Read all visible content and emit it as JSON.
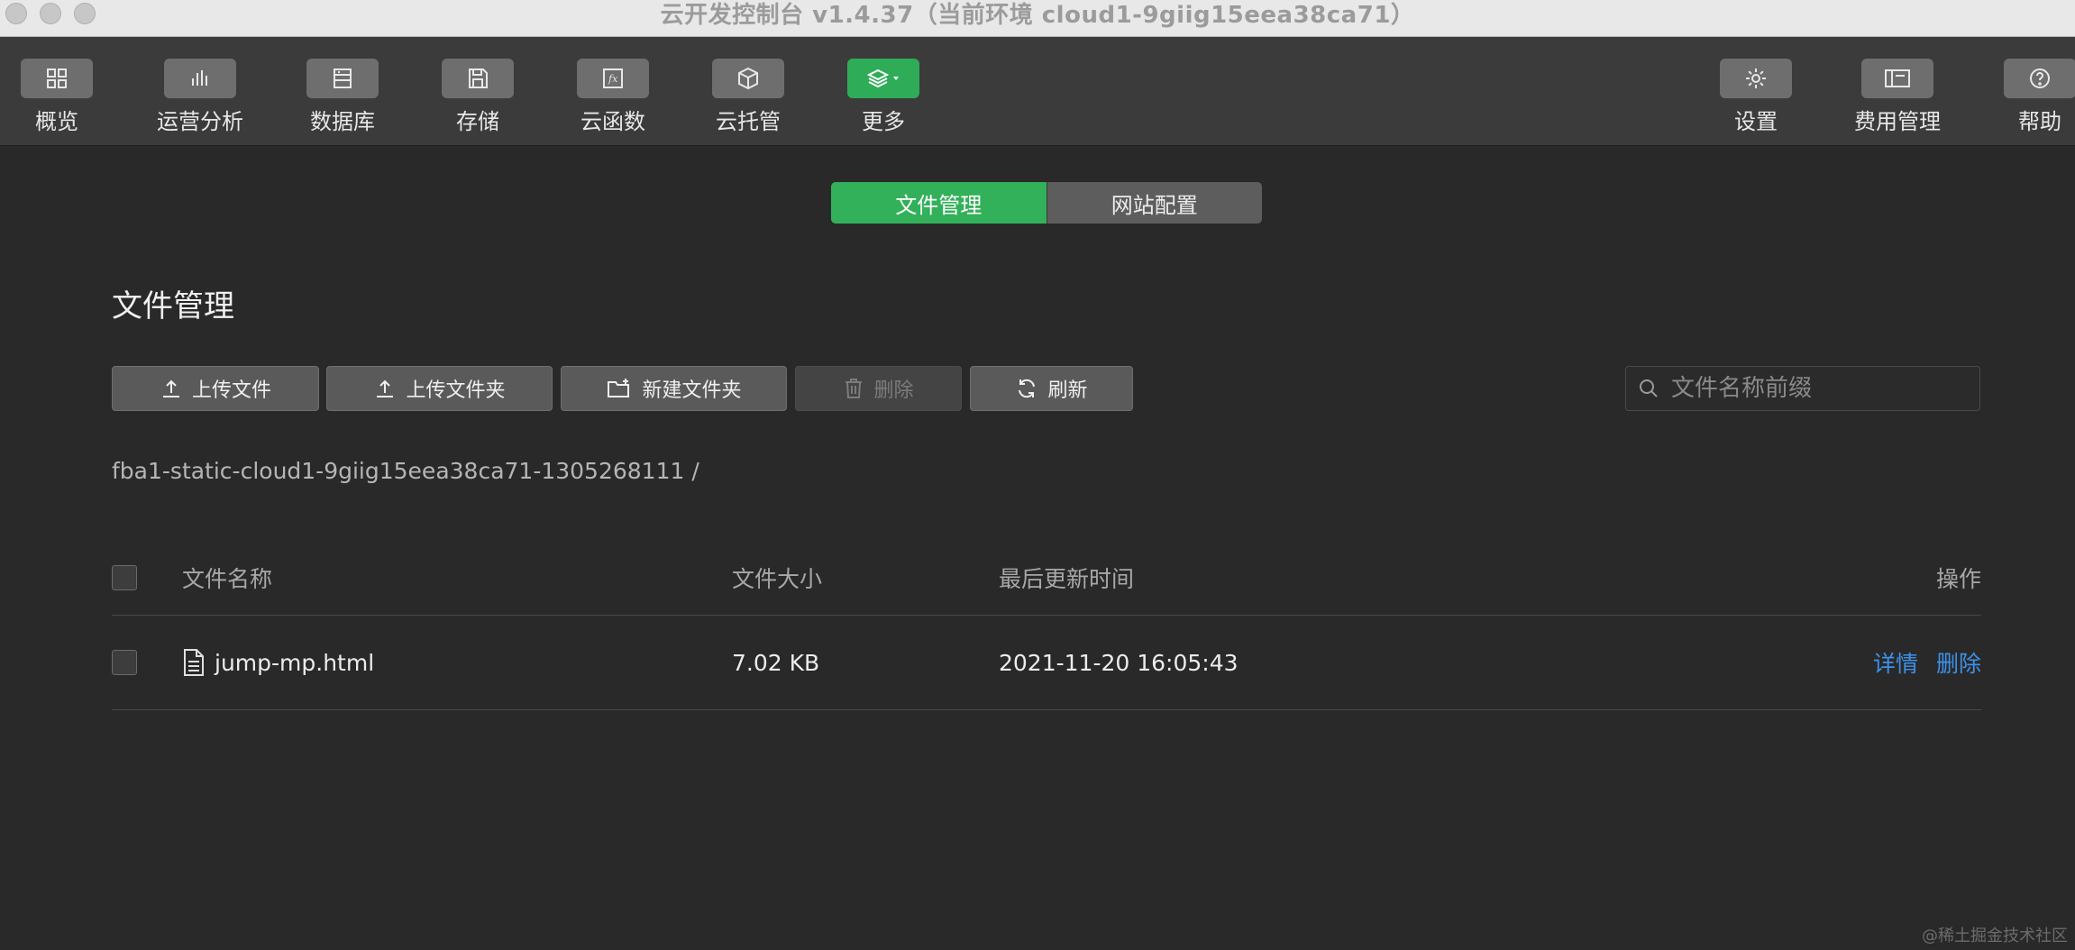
{
  "window": {
    "title": "云开发控制台 v1.4.37（当前环境 cloud1-9giig15eea38ca71）"
  },
  "toolbar": {
    "items": [
      {
        "label": "概览",
        "icon": "grid-icon"
      },
      {
        "label": "运营分析",
        "icon": "bar-chart-icon"
      },
      {
        "label": "数据库",
        "icon": "database-icon"
      },
      {
        "label": "存储",
        "icon": "save-disk-icon"
      },
      {
        "label": "云函数",
        "icon": "function-icon"
      },
      {
        "label": "云托管",
        "icon": "cube-icon"
      },
      {
        "label": "更多",
        "icon": "layers-icon"
      },
      {
        "label": "设置",
        "icon": "gear-icon"
      },
      {
        "label": "费用管理",
        "icon": "billing-icon"
      },
      {
        "label": "帮助",
        "icon": "help-icon"
      }
    ],
    "accent": "#2fac58"
  },
  "tabs": [
    {
      "label": "文件管理",
      "active": true
    },
    {
      "label": "网站配置",
      "active": false
    }
  ],
  "page": {
    "title": "文件管理"
  },
  "actions": {
    "upload_file": "上传文件",
    "upload_folder": "上传文件夹",
    "new_folder": "新建文件夹",
    "delete": "删除",
    "refresh": "刷新"
  },
  "search": {
    "placeholder": "文件名称前缀"
  },
  "breadcrumb": "fba1-static-cloud1-9giig15eea38ca71-1305268111 /",
  "table": {
    "columns": [
      "文件名称",
      "文件大小",
      "最后更新时间",
      "操作"
    ],
    "rows": [
      {
        "name": "jump-mp.html",
        "size": "7.02 KB",
        "updated": "2021-11-20 16:05:43",
        "actions": [
          "详情",
          "删除"
        ]
      }
    ]
  },
  "watermark": "@稀土掘金技术社区"
}
